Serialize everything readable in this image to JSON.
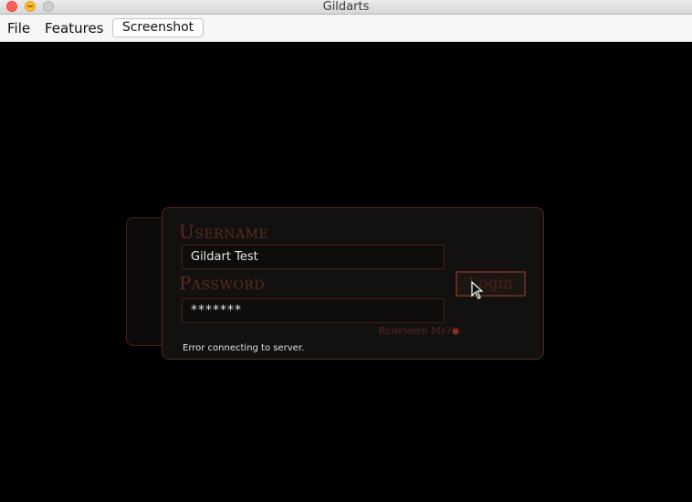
{
  "window": {
    "title": "Gildarts"
  },
  "menubar": {
    "items": [
      {
        "label": "File"
      },
      {
        "label": "Features"
      }
    ],
    "screenshot_label": "Screenshot"
  },
  "login": {
    "username_label": "Username",
    "username_value": "Gildart Test",
    "password_label": "Password",
    "password_value": "*******",
    "login_button": "Login",
    "remember_label": "Remember Me?",
    "remember_checked": true,
    "error_message": "Error connecting to server."
  },
  "colors": {
    "background": "#000000",
    "accent": "#5b2a20",
    "panel_border": "#5a261c"
  }
}
